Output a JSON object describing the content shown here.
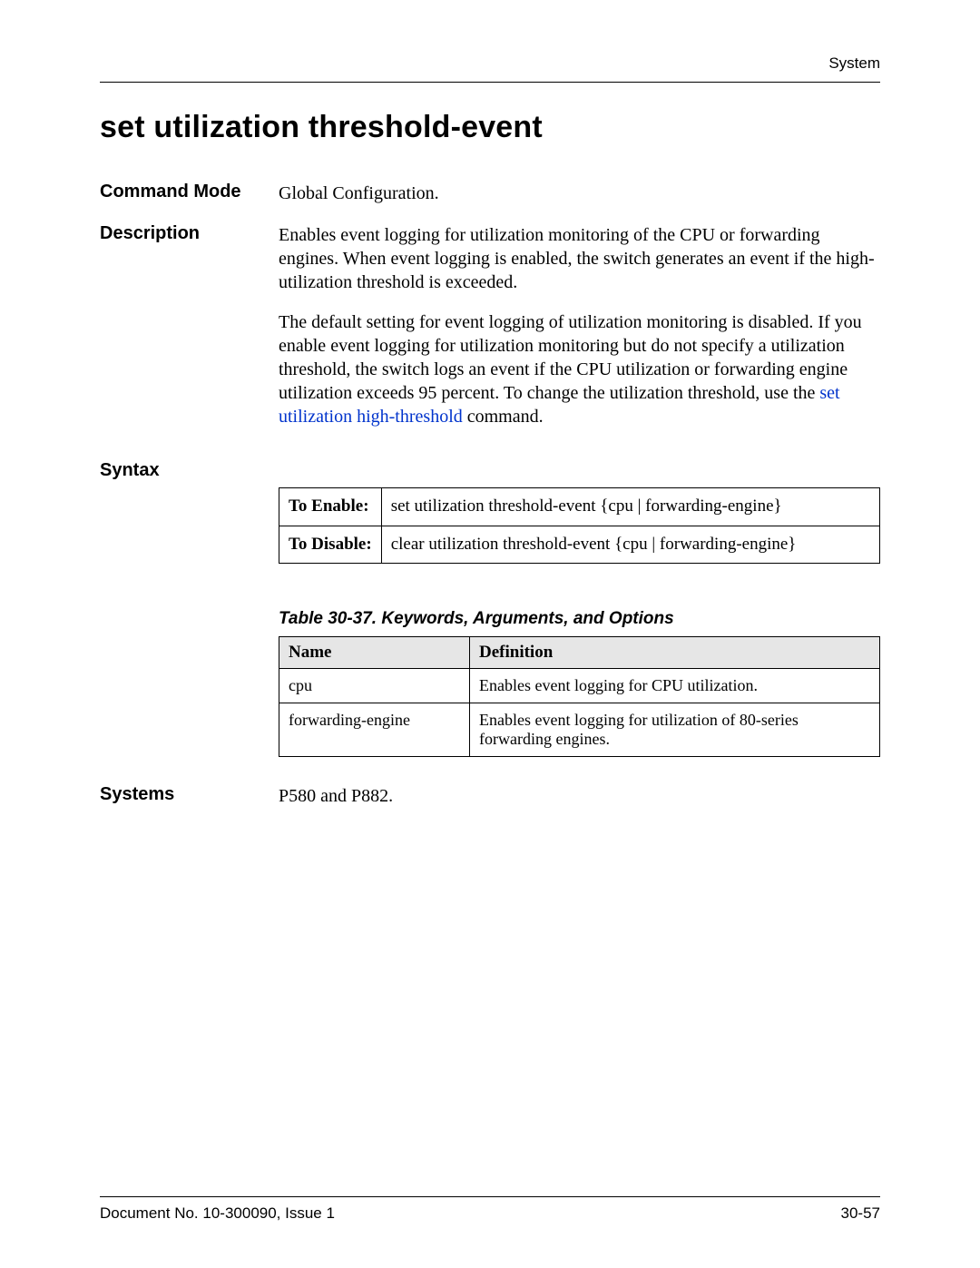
{
  "header": {
    "label": "System"
  },
  "title": "set utilization threshold-event",
  "sections": {
    "commandMode": {
      "label": "Command Mode",
      "value": "Global Configuration."
    },
    "description": {
      "label": "Description",
      "para1": "Enables event logging for utilization monitoring of the CPU or forwarding engines. When event logging is enabled, the switch generates an event if the high-utilization threshold is exceeded.",
      "para2_prefix": "The default setting for event logging of utilization monitoring is disabled. If you enable event logging for utilization monitoring but do not specify a utilization threshold, the switch logs an event if the CPU utilization or forwarding engine utilization exceeds 95 percent. To change the utilization threshold, use the ",
      "para2_link": "set utilization high-threshold",
      "para2_suffix": " command."
    },
    "syntax": {
      "label": "Syntax",
      "rows": {
        "enable": {
          "label": "To Enable:",
          "value": "set utilization threshold-event {cpu | forwarding-engine}"
        },
        "disable": {
          "label": "To Disable:",
          "value": "clear utilization threshold-event {cpu | forwarding-engine}"
        }
      }
    },
    "argsTable": {
      "caption": "Table 30-37.  Keywords, Arguments, and Options",
      "headers": {
        "name": "Name",
        "definition": "Definition"
      },
      "rows": [
        {
          "name": "cpu",
          "definition": "Enables event logging for CPU utilization."
        },
        {
          "name": "forwarding-engine",
          "definition": "Enables event logging for utilization of 80-series forwarding engines."
        }
      ]
    },
    "systems": {
      "label": "Systems",
      "value": "P580 and P882."
    }
  },
  "footer": {
    "left": "Document No. 10-300090, Issue 1",
    "right": "30-57"
  }
}
